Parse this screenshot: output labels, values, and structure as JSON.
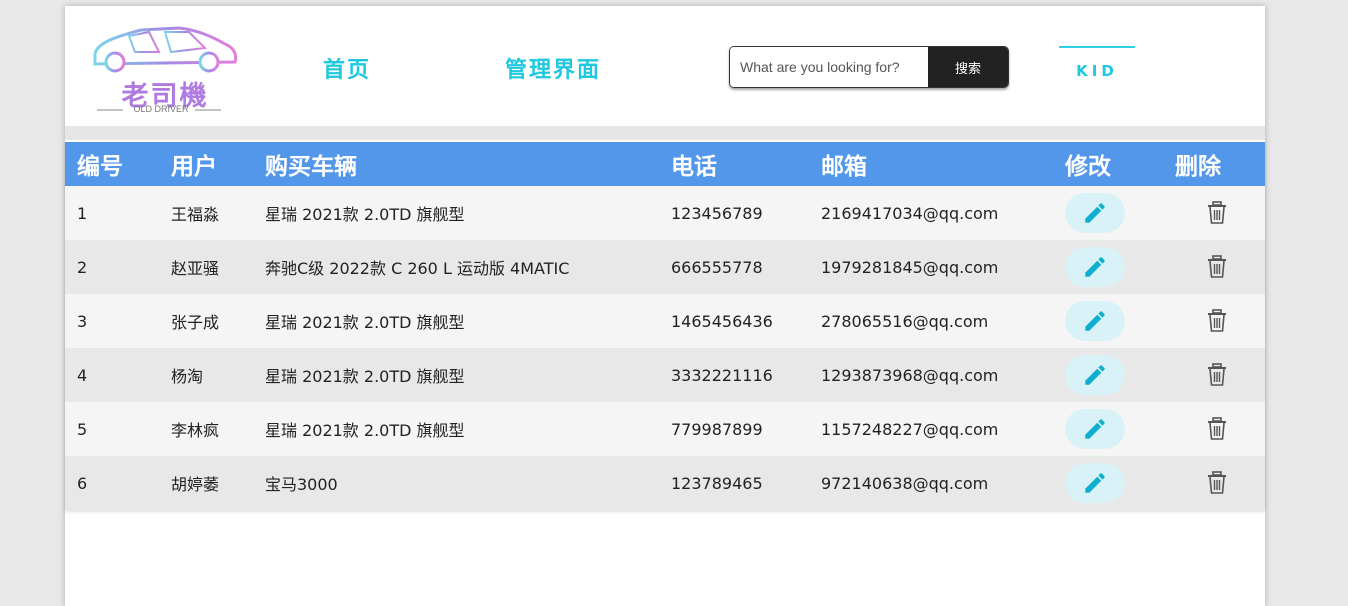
{
  "logo": {
    "title": "老司機",
    "subtitle": "OLD DRIVER"
  },
  "nav": {
    "home": "首页",
    "admin": "管理界面"
  },
  "search": {
    "placeholder": "What are you looking for?",
    "button": "搜索"
  },
  "user_label": "KID",
  "table": {
    "headers": [
      "编号",
      "用户",
      "购买车辆",
      "电话",
      "邮箱",
      "修改",
      "删除"
    ],
    "rows": [
      {
        "id": "1",
        "user": "王福淼",
        "car": "星瑞 2021款 2.0TD 旗舰型",
        "phone": "123456789",
        "email": "2169417034@qq.com"
      },
      {
        "id": "2",
        "user": "赵亚骚",
        "car": "奔驰C级 2022款 C 260 L 运动版 4MATIC",
        "phone": "666555778",
        "email": "1979281845@qq.com"
      },
      {
        "id": "3",
        "user": "张子成",
        "car": "星瑞 2021款 2.0TD 旗舰型",
        "phone": "1465456436",
        "email": "278065516@qq.com"
      },
      {
        "id": "4",
        "user": "杨淘",
        "car": "星瑞 2021款 2.0TD 旗舰型",
        "phone": "3332221116",
        "email": "1293873968@qq.com"
      },
      {
        "id": "5",
        "user": "李林疯",
        "car": "星瑞 2021款 2.0TD 旗舰型",
        "phone": "779987899",
        "email": "1157248227@qq.com"
      },
      {
        "id": "6",
        "user": "胡婷萎",
        "car": "宝马3000",
        "phone": "123789465",
        "email": "972140638@qq.com"
      }
    ]
  },
  "icons": {
    "edit": "pencil-icon",
    "delete": "trash-icon"
  },
  "colors": {
    "accent": "#1ec8df",
    "header_bg": "#5397eb",
    "edit_bg": "#d9f2f8",
    "pencil": "#0fb0cf"
  }
}
